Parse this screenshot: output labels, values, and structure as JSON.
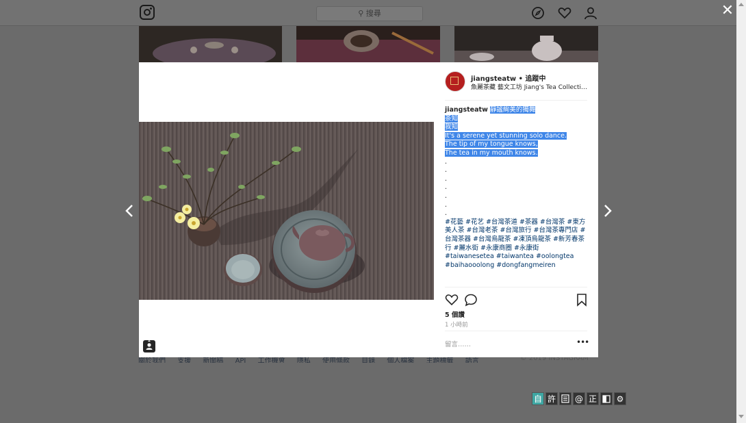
{
  "background": {
    "search_placeholder": "搜尋",
    "footer_links": [
      "關於我們",
      "支援",
      "新聞稿",
      "API",
      "工作機會",
      "隱私",
      "使用條款",
      "目錄",
      "個人檔案",
      "主題標籤",
      "語言"
    ],
    "copyright": "© 2019 INSTAGRAM"
  },
  "post": {
    "username": "jiangsteatw",
    "separator": " • ",
    "follow_status": "追蹤中",
    "location": "魚麗茶藏 藝文工坊 Jiang's Tea Collection",
    "caption": {
      "username": "jiangsteatw",
      "selected_lines": [
        "靜謐絢美的獨舞",
        "茶知",
        "我知",
        "It's a serene yet stunning solo dance.",
        "The tip of my tongue knows,",
        "The tea in my mouth knows."
      ],
      "dots": [
        ".",
        ".",
        ".",
        ".",
        ".",
        ".",
        "."
      ],
      "hashtags_zh": "#花藝 #花艺 #台灣茶道 #茶器 #台灣茶 #東方美人茶 #台灣老茶 #台灣旅行 #台灣茶專門店 #台灣茶器 #台灣烏龍茶 #凍頂烏龍茶 #新芳春茶行 #麗水街 #永康商圈 #永康街",
      "hashtags_en": "#taiwanesetea #taiwantea #oolongtea #baihaooolong #dongfangmeiren"
    },
    "likes": "5 個讚",
    "time_ago": "1 小時前",
    "comment_placeholder": "留言……",
    "more_label": "•••"
  },
  "ext_toolbar": [
    "自",
    "許",
    "",
    "@",
    "正",
    "",
    "⚙"
  ],
  "colors": {
    "selection": "#3f86e8",
    "hashtag": "#003569",
    "ext_active": "#3ea7a3"
  }
}
